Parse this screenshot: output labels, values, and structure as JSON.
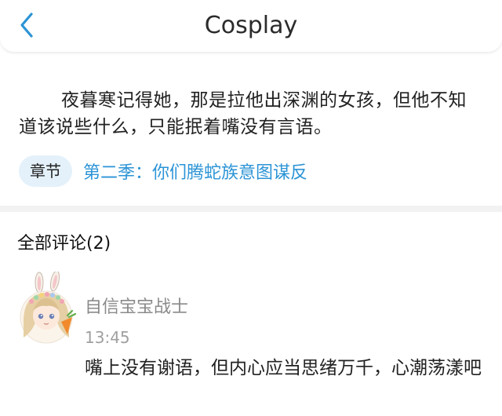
{
  "header": {
    "title": "Cosplay"
  },
  "quote": {
    "text": "夜暮寒记得她，那是拉他出深渊的女孩，但他不知道该说些什么，只能抿着嘴没有言语。"
  },
  "chapter": {
    "tag_label": "章节",
    "link_text": "第二季：你们腾蛇族意图谋反"
  },
  "comments": {
    "header": "全部评论(2)",
    "items": [
      {
        "username": "自信宝宝战士",
        "time": "13:45",
        "text": "嘴上没有谢语，但内心应当思绪万千，心潮荡漾吧"
      }
    ]
  },
  "colors": {
    "accent": "#2c94d6",
    "tag_bg": "#e4f1fb",
    "muted": "#8a8a8a"
  }
}
